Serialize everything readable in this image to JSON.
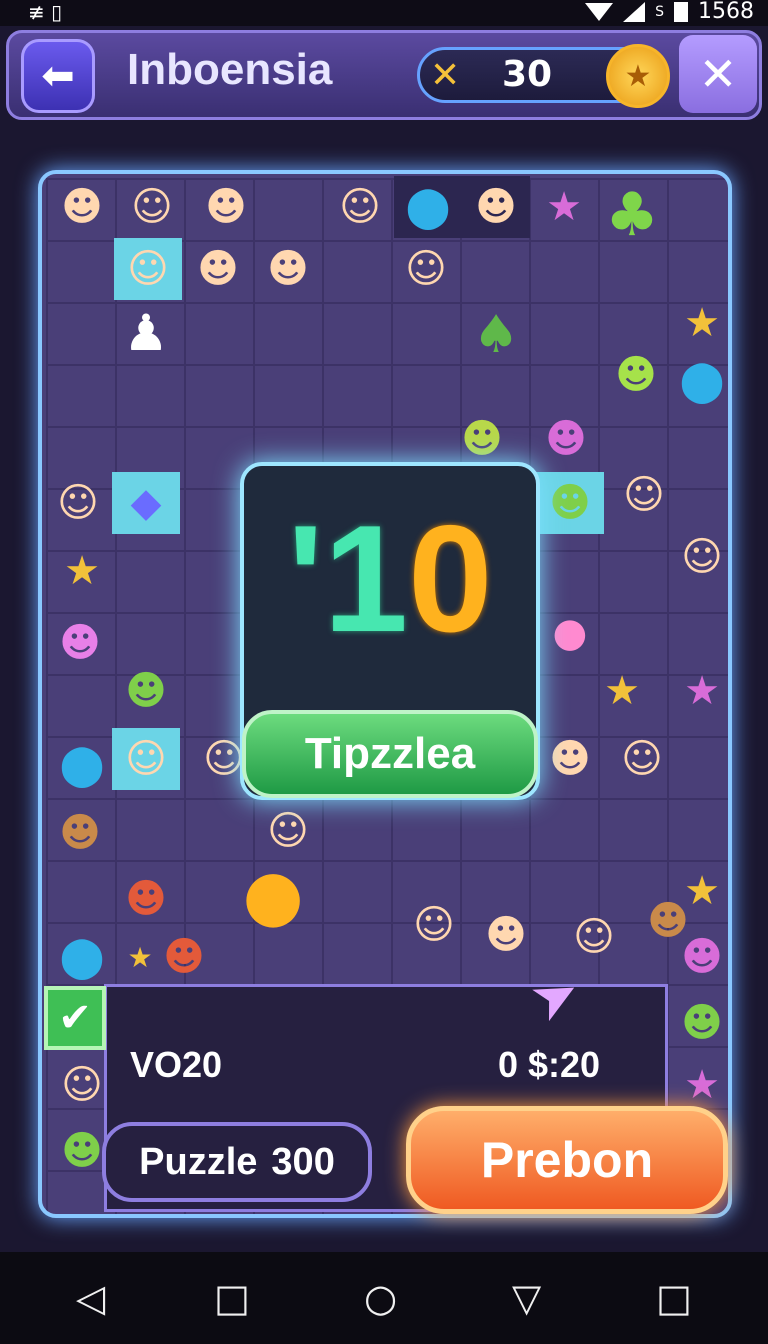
{
  "status_bar": {
    "left": "≢ ▯",
    "right_label": "S",
    "time": "1568"
  },
  "topbar": {
    "title": "Inboensia",
    "coin_prefix": "✕",
    "coin_value": "30",
    "back_icon": "back-arrow-icon",
    "close_icon": "close-icon",
    "coin_icon": "star-coin-icon"
  },
  "modal": {
    "score_a": "'1",
    "score_b": "0",
    "button": "Tipzzlea"
  },
  "bottom": {
    "stat_left": "VO20",
    "stat_right": "0  $:20",
    "puzzle_label": "Puzzle",
    "puzzle_value": "300",
    "action_button": "Prebon"
  },
  "navbar": {
    "back": "◁",
    "home": "○",
    "recent": "□",
    "extra_left": "□",
    "extra_right": "▽"
  },
  "colors": {
    "accent": "#8e7ee0",
    "board_glow": "#8ac8ff",
    "score_green": "#47e7b0",
    "score_orange": "#ffb21e",
    "tip_green": "#1f9a45",
    "prebon_orange": "#ef5a22"
  }
}
